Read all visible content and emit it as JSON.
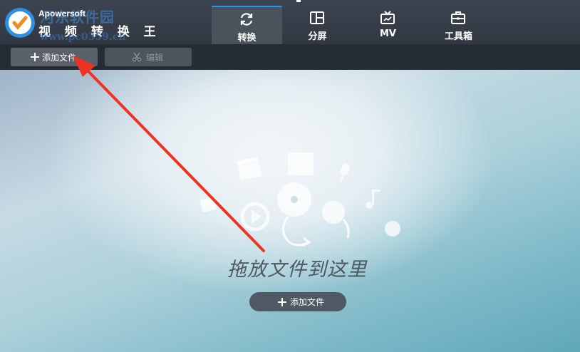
{
  "app": {
    "vendor": "Apowersoft",
    "title": "视 频 转 换 王",
    "watermark_text": "河东软件园",
    "watermark_url": "www.pc0359.cn"
  },
  "tabs": [
    {
      "label": "转换",
      "icon": "refresh-icon",
      "active": true
    },
    {
      "label": "分屏",
      "icon": "split-screen-icon",
      "active": false
    },
    {
      "label": "MV",
      "icon": "tv-icon",
      "active": false
    },
    {
      "label": "工具箱",
      "icon": "toolbox-icon",
      "active": false
    }
  ],
  "toolbar": {
    "add_label": "添加文件",
    "edit_label": "编辑"
  },
  "drop_area": {
    "hint": "拖放文件到这里",
    "add_label": "添加文件"
  },
  "colors": {
    "accent": "#1e9af0",
    "header_bg": "#3c4450",
    "toolbar_bg": "#262c34",
    "annotation_red": "#ee3322"
  }
}
